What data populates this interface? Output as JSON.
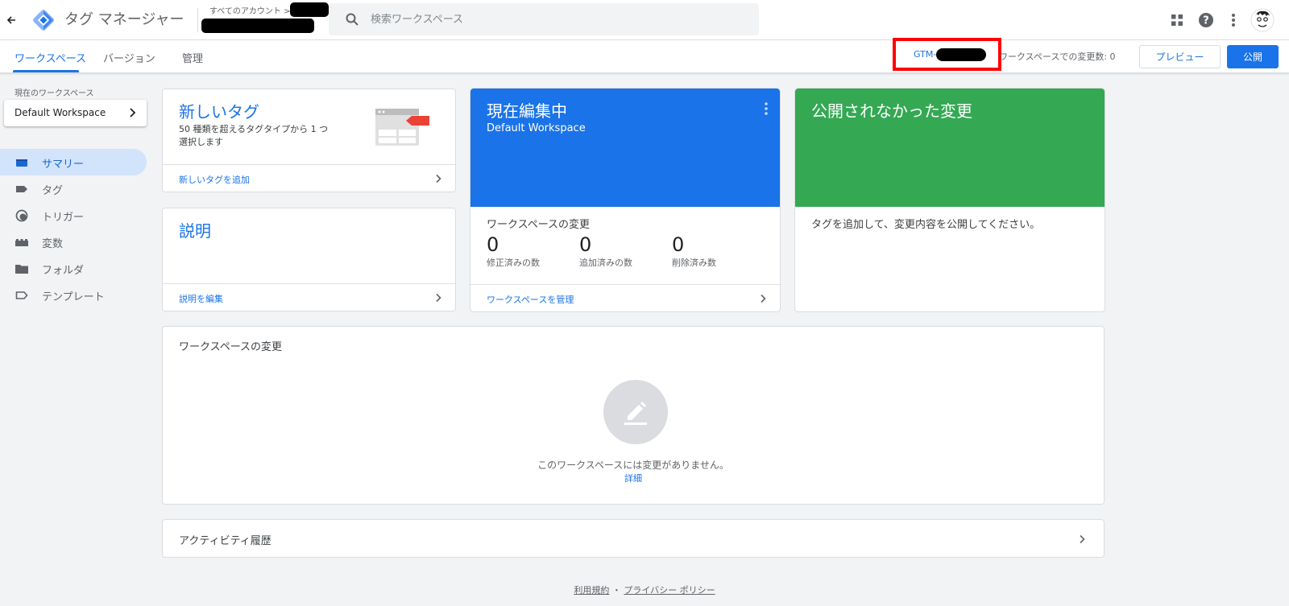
{
  "header": {
    "app_title": "タグ マネージャー",
    "breadcrumb_root": "すべてのアカウント >",
    "search_placeholder": "検索ワークスペース"
  },
  "subnav": {
    "tabs": [
      {
        "label": "ワークスペース",
        "active": true
      },
      {
        "label": "バージョン",
        "active": false
      },
      {
        "label": "管理",
        "active": false
      }
    ],
    "container_id_prefix": "GTM-",
    "changes_label": "ワークスペースでの変更数: 0",
    "preview_label": "プレビュー",
    "publish_label": "公開"
  },
  "sidebar": {
    "workspace_caption": "現在のワークスペース",
    "workspace_name": "Default Workspace",
    "items": [
      {
        "label": "サマリー",
        "icon": "summary-icon",
        "active": true
      },
      {
        "label": "タグ",
        "icon": "tag-icon",
        "active": false
      },
      {
        "label": "トリガー",
        "icon": "trigger-icon",
        "active": false
      },
      {
        "label": "変数",
        "icon": "variable-icon",
        "active": false
      },
      {
        "label": "フォルダ",
        "icon": "folder-icon",
        "active": false
      },
      {
        "label": "テンプレート",
        "icon": "template-icon",
        "active": false
      }
    ]
  },
  "cards": {
    "new_tag": {
      "title": "新しいタグ",
      "description": "50 種類を超えるタグタイプから 1 つ選択します",
      "link": "新しいタグを追加"
    },
    "description": {
      "title": "説明",
      "link": "説明を編集"
    },
    "editing": {
      "title": "現在編集中",
      "subtitle": "Default Workspace",
      "changes_title": "ワークスペースの変更",
      "stats": [
        {
          "value": "0",
          "label": "修正済みの数"
        },
        {
          "value": "0",
          "label": "追加済みの数"
        },
        {
          "value": "0",
          "label": "削除済み数"
        }
      ],
      "link": "ワークスペースを管理"
    },
    "unpublished": {
      "title": "公開されなかった変更",
      "body": "タグを追加して、変更内容を公開してください。"
    },
    "workspace_changes": {
      "title": "ワークスペースの変更",
      "empty_text": "このワークスペースには変更がありません。",
      "details_link": "詳細"
    },
    "activity": {
      "title": "アクティビティ履歴"
    }
  },
  "footer": {
    "terms": "利用規約",
    "separator": "・",
    "privacy": "プライバシー ポリシー"
  },
  "colors": {
    "accent": "#1a73e8",
    "green": "#34a853",
    "highlight_border": "#ff0000"
  }
}
